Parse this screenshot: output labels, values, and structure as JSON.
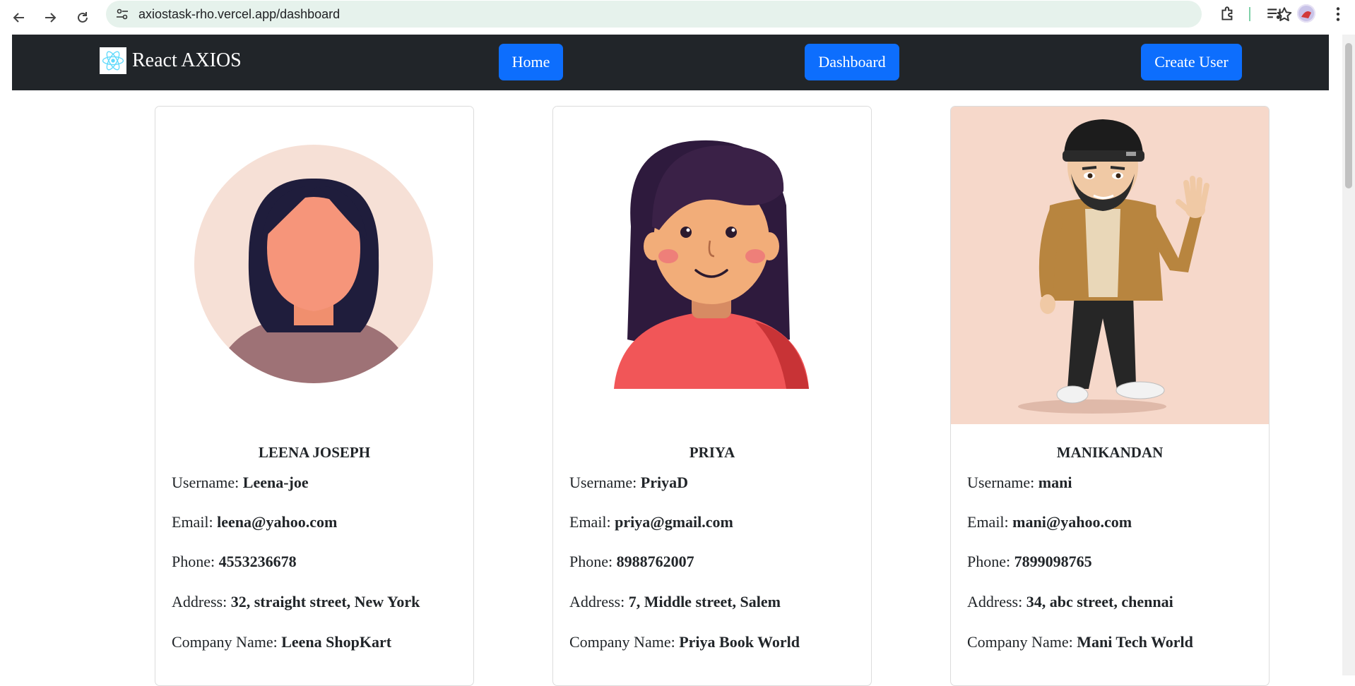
{
  "browser": {
    "url": "axiostask-rho.vercel.app/dashboard"
  },
  "navbar": {
    "brand": "React AXIOS",
    "home_label": "Home",
    "dashboard_label": "Dashboard",
    "create_user_label": "Create User",
    "background": "#212529",
    "button_color": "#0d6efd"
  },
  "labels": {
    "username": "Username:",
    "email": "Email:",
    "phone": "Phone:",
    "address": "Address:",
    "company": "Company Name:"
  },
  "users": [
    {
      "name": "LEENA JOSEPH",
      "username": "Leena-joe",
      "email": "leena@yahoo.com",
      "phone": "4553236678",
      "address": "32, straight street, New York",
      "company": "Leena ShopKart",
      "avatar": "faceless-woman-avatar"
    },
    {
      "name": "PRIYA",
      "username": "PriyaD",
      "email": "priya@gmail.com",
      "phone": "8988762007",
      "address": "7, Middle street, Salem",
      "company": "Priya Book World",
      "avatar": "cartoon-girl-avatar"
    },
    {
      "name": "MANIKANDAN",
      "username": "mani",
      "email": "mani@yahoo.com",
      "phone": "7899098765",
      "address": "34, abc street, chennai",
      "company": "Mani Tech World",
      "avatar": "cartoon-man-waving-avatar"
    }
  ]
}
